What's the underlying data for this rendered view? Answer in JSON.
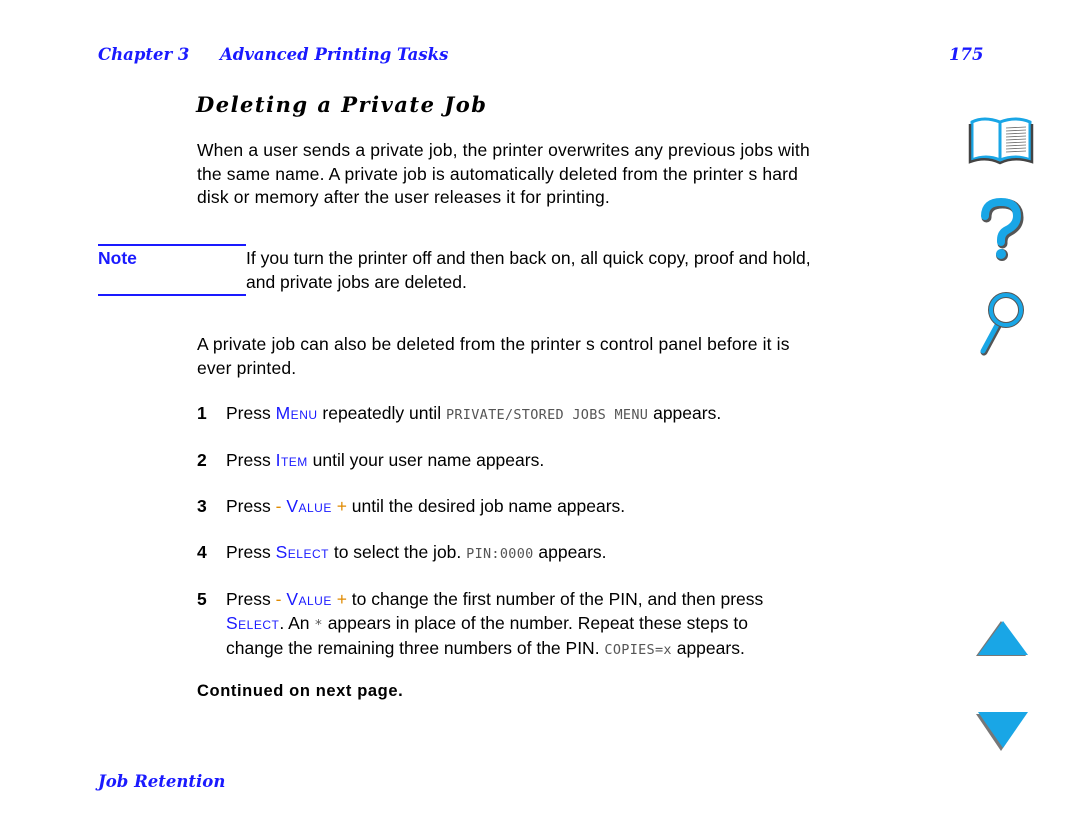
{
  "header": {
    "chapter": "Chapter 3",
    "chapter_title": "Advanced Printing Tasks",
    "page_number": "175"
  },
  "section_title": "Deleting a Private Job",
  "intro_lines": [
    "When a user sends a private job, the printer overwrites any previous jobs with",
    "the same name. A private job is automatically deleted from the printer s hard",
    "disk or memory after the user releases it for printing."
  ],
  "note": {
    "label": "Note",
    "lines": [
      "If you turn the printer off and then back on, all quick copy, proof and hold,",
      "and private jobs are deleted."
    ]
  },
  "para2_lines": [
    "A private job can also be deleted from the printer s control panel before it is",
    "ever printed."
  ],
  "steps": [
    {
      "num": "1",
      "pre": "Press ",
      "key": "Menu",
      "mid": " repeatedly until ",
      "lcd": "PRIVATE/STORED JOBS MENU",
      "post": " appears."
    },
    {
      "num": "2",
      "pre": "Press ",
      "key": "Item",
      "post": " until your user name appears."
    },
    {
      "num": "3",
      "pre": "Press ",
      "minus": "- ",
      "key": "Value",
      "plus": " +",
      "post": " until the desired job name appears."
    },
    {
      "num": "4",
      "pre": "Press ",
      "key": "Select",
      "mid": " to select the job. ",
      "lcd": "PIN:0000",
      "post": " appears."
    },
    {
      "num": "5",
      "pre": "Press ",
      "minus": "- ",
      "key": "Value",
      "plus": " +",
      "post": " to change the first number of the PIN, and then press",
      "line2_key": "Select",
      "line2_post_a": ". An ",
      "line2_lcd": "*",
      "line2_post_b": " appears in place of the number. Repeat these steps to",
      "line3_pre": "change the remaining three numbers of the PIN. ",
      "line3_lcd": "COPIES=x",
      "line3_post": " appears."
    }
  ],
  "continued": "Continued on next page.",
  "footer": "Job Retention",
  "nav_icons": [
    "book-icon",
    "help-icon",
    "search-icon",
    "previous-page-icon",
    "next-page-icon"
  ],
  "colors": {
    "accent_blue": "#1a1aff",
    "icon_blue": "#19a6e6",
    "orange": "#e08a00"
  }
}
